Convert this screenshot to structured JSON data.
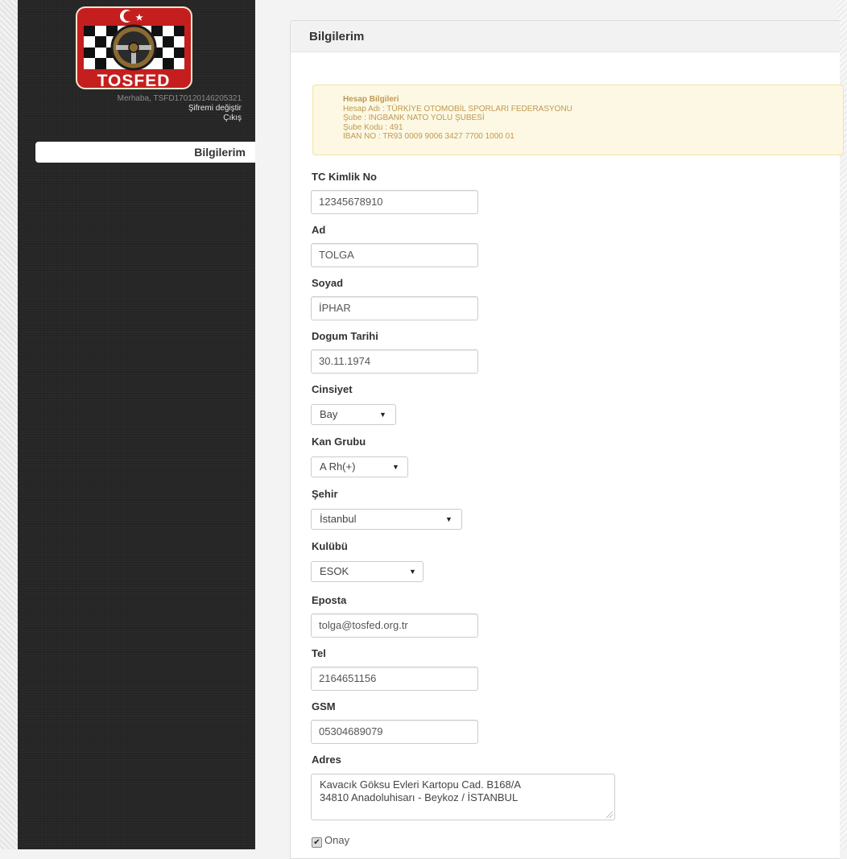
{
  "brand": {
    "logo_text": "TOSFED"
  },
  "user": {
    "greeting": "Merhaba, TSFD170120146205321",
    "change_password": "Şifremi değiştir",
    "logout": "Çıkış"
  },
  "nav": {
    "active_item": "Bilgilerim"
  },
  "panel": {
    "title": "Bilgilerim"
  },
  "account_info": {
    "title": "Hesap Bilgileri",
    "lines": [
      "Hesap Adı : TÜRKİYE OTOMOBİL SPORLARI FEDERASYONU",
      "Şube : INGBANK NATO YOLU ŞUBESİ",
      "Şube Kodu : 491",
      "IBAN NO : TR93 0009 9006 3427 7700 1000 01"
    ]
  },
  "form": {
    "tc": {
      "label": "TC Kimlik No",
      "value": "12345678910"
    },
    "ad": {
      "label": "Ad",
      "value": "TOLGA"
    },
    "soyad": {
      "label": "Soyad",
      "value": "İPHAR"
    },
    "dogum": {
      "label": "Dogum Tarihi",
      "value": "30.11.1974"
    },
    "cinsiyet": {
      "label": "Cinsiyet",
      "value": "Bay"
    },
    "kan": {
      "label": "Kan Grubu",
      "value": "A Rh(+)"
    },
    "sehir": {
      "label": "Şehir",
      "value": "İstanbul"
    },
    "kulup": {
      "label": "Kulübü",
      "value": "ESOK"
    },
    "eposta": {
      "label": "Eposta",
      "value": "tolga@tosfed.org.tr"
    },
    "tel": {
      "label": "Tel",
      "value": "2164651156"
    },
    "gsm": {
      "label": "GSM",
      "value": "05304689079"
    },
    "adres": {
      "label": "Adres",
      "line1": "Kavacık Göksu Evleri Kartopu Cad. B168/A",
      "line2": "34810 Anadoluhisarı - Beykoz / İSTANBUL"
    },
    "onay": {
      "label": "Onay",
      "checked": true
    }
  },
  "colors": {
    "sidebar": "#262626",
    "logo_red": "#c41e1e",
    "alert_bg": "#fcf8e3",
    "alert_text": "#c09853"
  },
  "icons": {
    "select_arrow": "caret-down-icon",
    "checkbox": "check-icon"
  }
}
